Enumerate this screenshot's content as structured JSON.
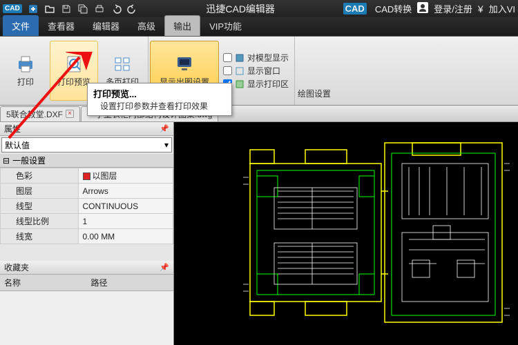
{
  "titlebar": {
    "app_title": "迅捷CAD编辑器",
    "cad_convert": "CAD转换",
    "login": "登录/注册",
    "join": "加入VI"
  },
  "menus": {
    "file": "文件",
    "viewer": "查看器",
    "editor": "编辑器",
    "advanced": "高级",
    "output": "输出",
    "vip": "VIP功能"
  },
  "ribbon": {
    "print": "打印",
    "print_preview": "打印预览",
    "multi_print": "多页打印",
    "plot_settings": "显示出图设置",
    "model_display": "对模型显示",
    "window_display": "显示窗口",
    "print_area": "显示打印区",
    "draw_settings": "绘图设置"
  },
  "tooltip": {
    "title": "打印预览...",
    "body": "设置打印参数并查看打印效果"
  },
  "doctabs": {
    "tab1": "5联合教堂.DXF",
    "tab2": "一字型衣柜内部结构设计图集.dwg"
  },
  "panel": {
    "props_title": "属性",
    "default": "默认值",
    "general": "一般设置",
    "rows": [
      {
        "k": "色彩",
        "v": "以图层",
        "color": true
      },
      {
        "k": "图层",
        "v": "Arrows"
      },
      {
        "k": "线型",
        "v": "CONTINUOUS"
      },
      {
        "k": "线型比例",
        "v": "1"
      },
      {
        "k": "线宽",
        "v": "0.00 MM"
      }
    ],
    "fav_title": "收藏夹",
    "col_name": "名称",
    "col_path": "路径"
  }
}
